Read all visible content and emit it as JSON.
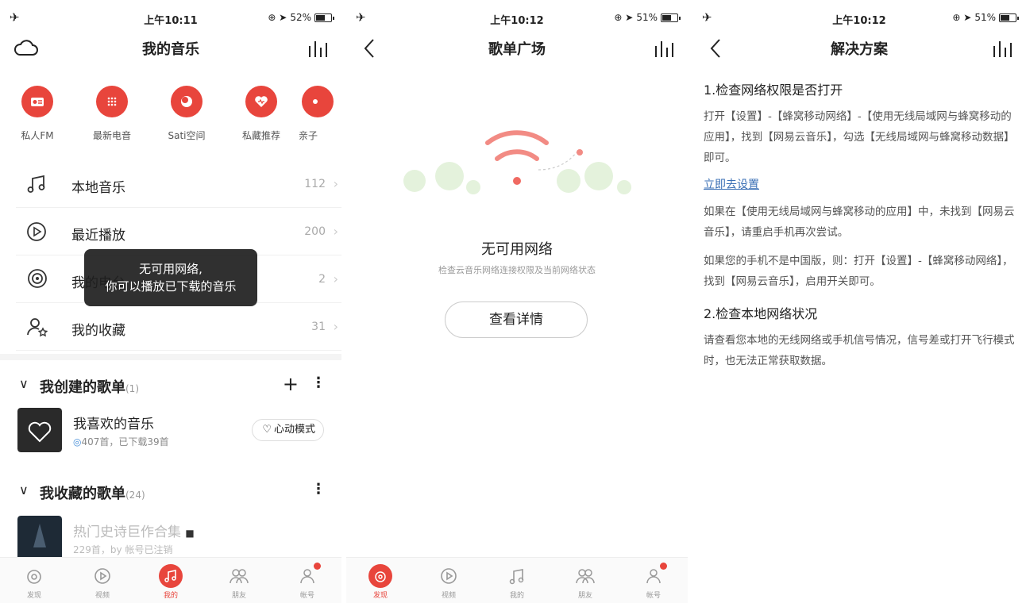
{
  "colors": {
    "accent": "#e8453c",
    "link": "#3a6fb5"
  },
  "screen1": {
    "status": {
      "time": "上午10:11",
      "battery": "52%"
    },
    "title": "我的音乐",
    "quick": [
      {
        "label": "私人FM",
        "icon": "radio-icon"
      },
      {
        "label": "最新电音",
        "icon": "speaker-icon"
      },
      {
        "label": "Sati空间",
        "icon": "moon-icon"
      },
      {
        "label": "私藏推荐",
        "icon": "heart-wave-icon"
      },
      {
        "label": "亲子",
        "icon": "kids-icon"
      }
    ],
    "rows": [
      {
        "label": "本地音乐",
        "count": "112"
      },
      {
        "label": "最近播放",
        "count": "200"
      },
      {
        "label": "我的电台",
        "count": "2"
      },
      {
        "label": "我的收藏",
        "count": "31"
      }
    ],
    "toast": {
      "line1": "无可用网络,",
      "line2": "你可以播放已下载的音乐"
    },
    "created": {
      "title": "我创建的歌单",
      "count": "(1)"
    },
    "fav_playlist": {
      "name": "我喜欢的音乐",
      "sub": "407首，已下载39首",
      "mode": "心动模式"
    },
    "collected": {
      "title": "我收藏的歌单",
      "count": "(24)"
    },
    "collected_playlist": {
      "name": "热门史诗巨作合集",
      "sub": "229首，by 帐号已注销"
    },
    "tabs": [
      "发现",
      "视频",
      "我的",
      "朋友",
      "帐号"
    ]
  },
  "screen2": {
    "status": {
      "time": "上午10:12",
      "battery": "51%"
    },
    "title": "歌单广场",
    "empty_title": "无可用网络",
    "empty_sub": "检查云音乐网络连接权限及当前网络状态",
    "button": "查看详情",
    "tabs": [
      "发现",
      "视频",
      "我的",
      "朋友",
      "帐号"
    ]
  },
  "screen3": {
    "status": {
      "time": "上午10:12",
      "battery": "51%"
    },
    "title": "解决方案",
    "h1": "1.检查网络权限是否打开",
    "p1": "打开【设置】-【蜂窝移动网络】-【使用无线局域网与蜂窝移动的应用】，找到【网易云音乐】，勾选【无线局域网与蜂窝移动数据】即可。",
    "link": "立即去设置",
    "p2": "如果在【使用无线局域网与蜂窝移动的应用】中，未找到【网易云音乐】，请重启手机再次尝试。",
    "p3": "如果您的手机不是中国版，则：打开【设置】-【蜂窝移动网络】，找到【网易云音乐】，启用开关即可。",
    "h2": "2.检查本地网络状况",
    "p4": "请查看您本地的无线网络或手机信号情况，信号差或打开飞行模式时，也无法正常获取数据。"
  }
}
